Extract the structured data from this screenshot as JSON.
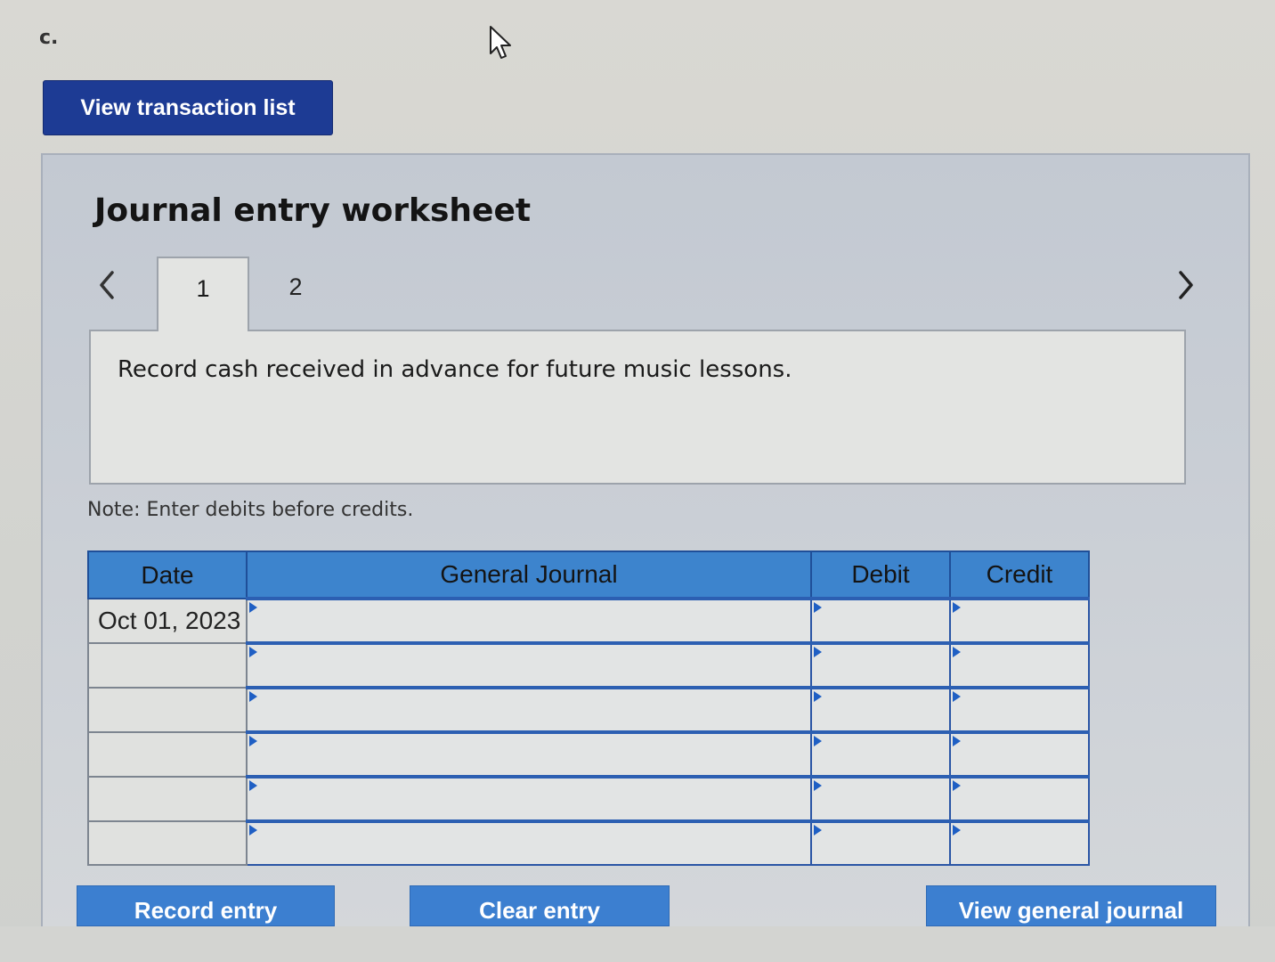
{
  "part_label": "c.",
  "buttons": {
    "view_transaction_list": "View transaction list",
    "record_entry": "Record entry",
    "clear_entry": "Clear entry",
    "view_general_journal": "View general journal"
  },
  "worksheet": {
    "title": "Journal entry worksheet",
    "tabs": [
      {
        "label": "1",
        "active": true
      },
      {
        "label": "2",
        "active": false
      }
    ],
    "description": "Record cash received in advance for future music lessons.",
    "note": "Note: Enter debits before credits."
  },
  "journal_table": {
    "headers": [
      "Date",
      "General Journal",
      "Debit",
      "Credit"
    ],
    "rows": [
      {
        "date": "Oct 01, 2023",
        "account": "",
        "debit": "",
        "credit": ""
      },
      {
        "date": "",
        "account": "",
        "debit": "",
        "credit": ""
      },
      {
        "date": "",
        "account": "",
        "debit": "",
        "credit": ""
      },
      {
        "date": "",
        "account": "",
        "debit": "",
        "credit": ""
      },
      {
        "date": "",
        "account": "",
        "debit": "",
        "credit": ""
      },
      {
        "date": "",
        "account": "",
        "debit": "",
        "credit": ""
      }
    ]
  },
  "icons": {
    "prev": "chevron-left-icon",
    "next": "chevron-right-icon",
    "cursor": "mouse-pointer-icon"
  },
  "colors": {
    "dark_button": "#1d3b94",
    "header_blue": "#3d84cd",
    "action_button": "#3c7fd0",
    "panel": "#c9ced5"
  }
}
